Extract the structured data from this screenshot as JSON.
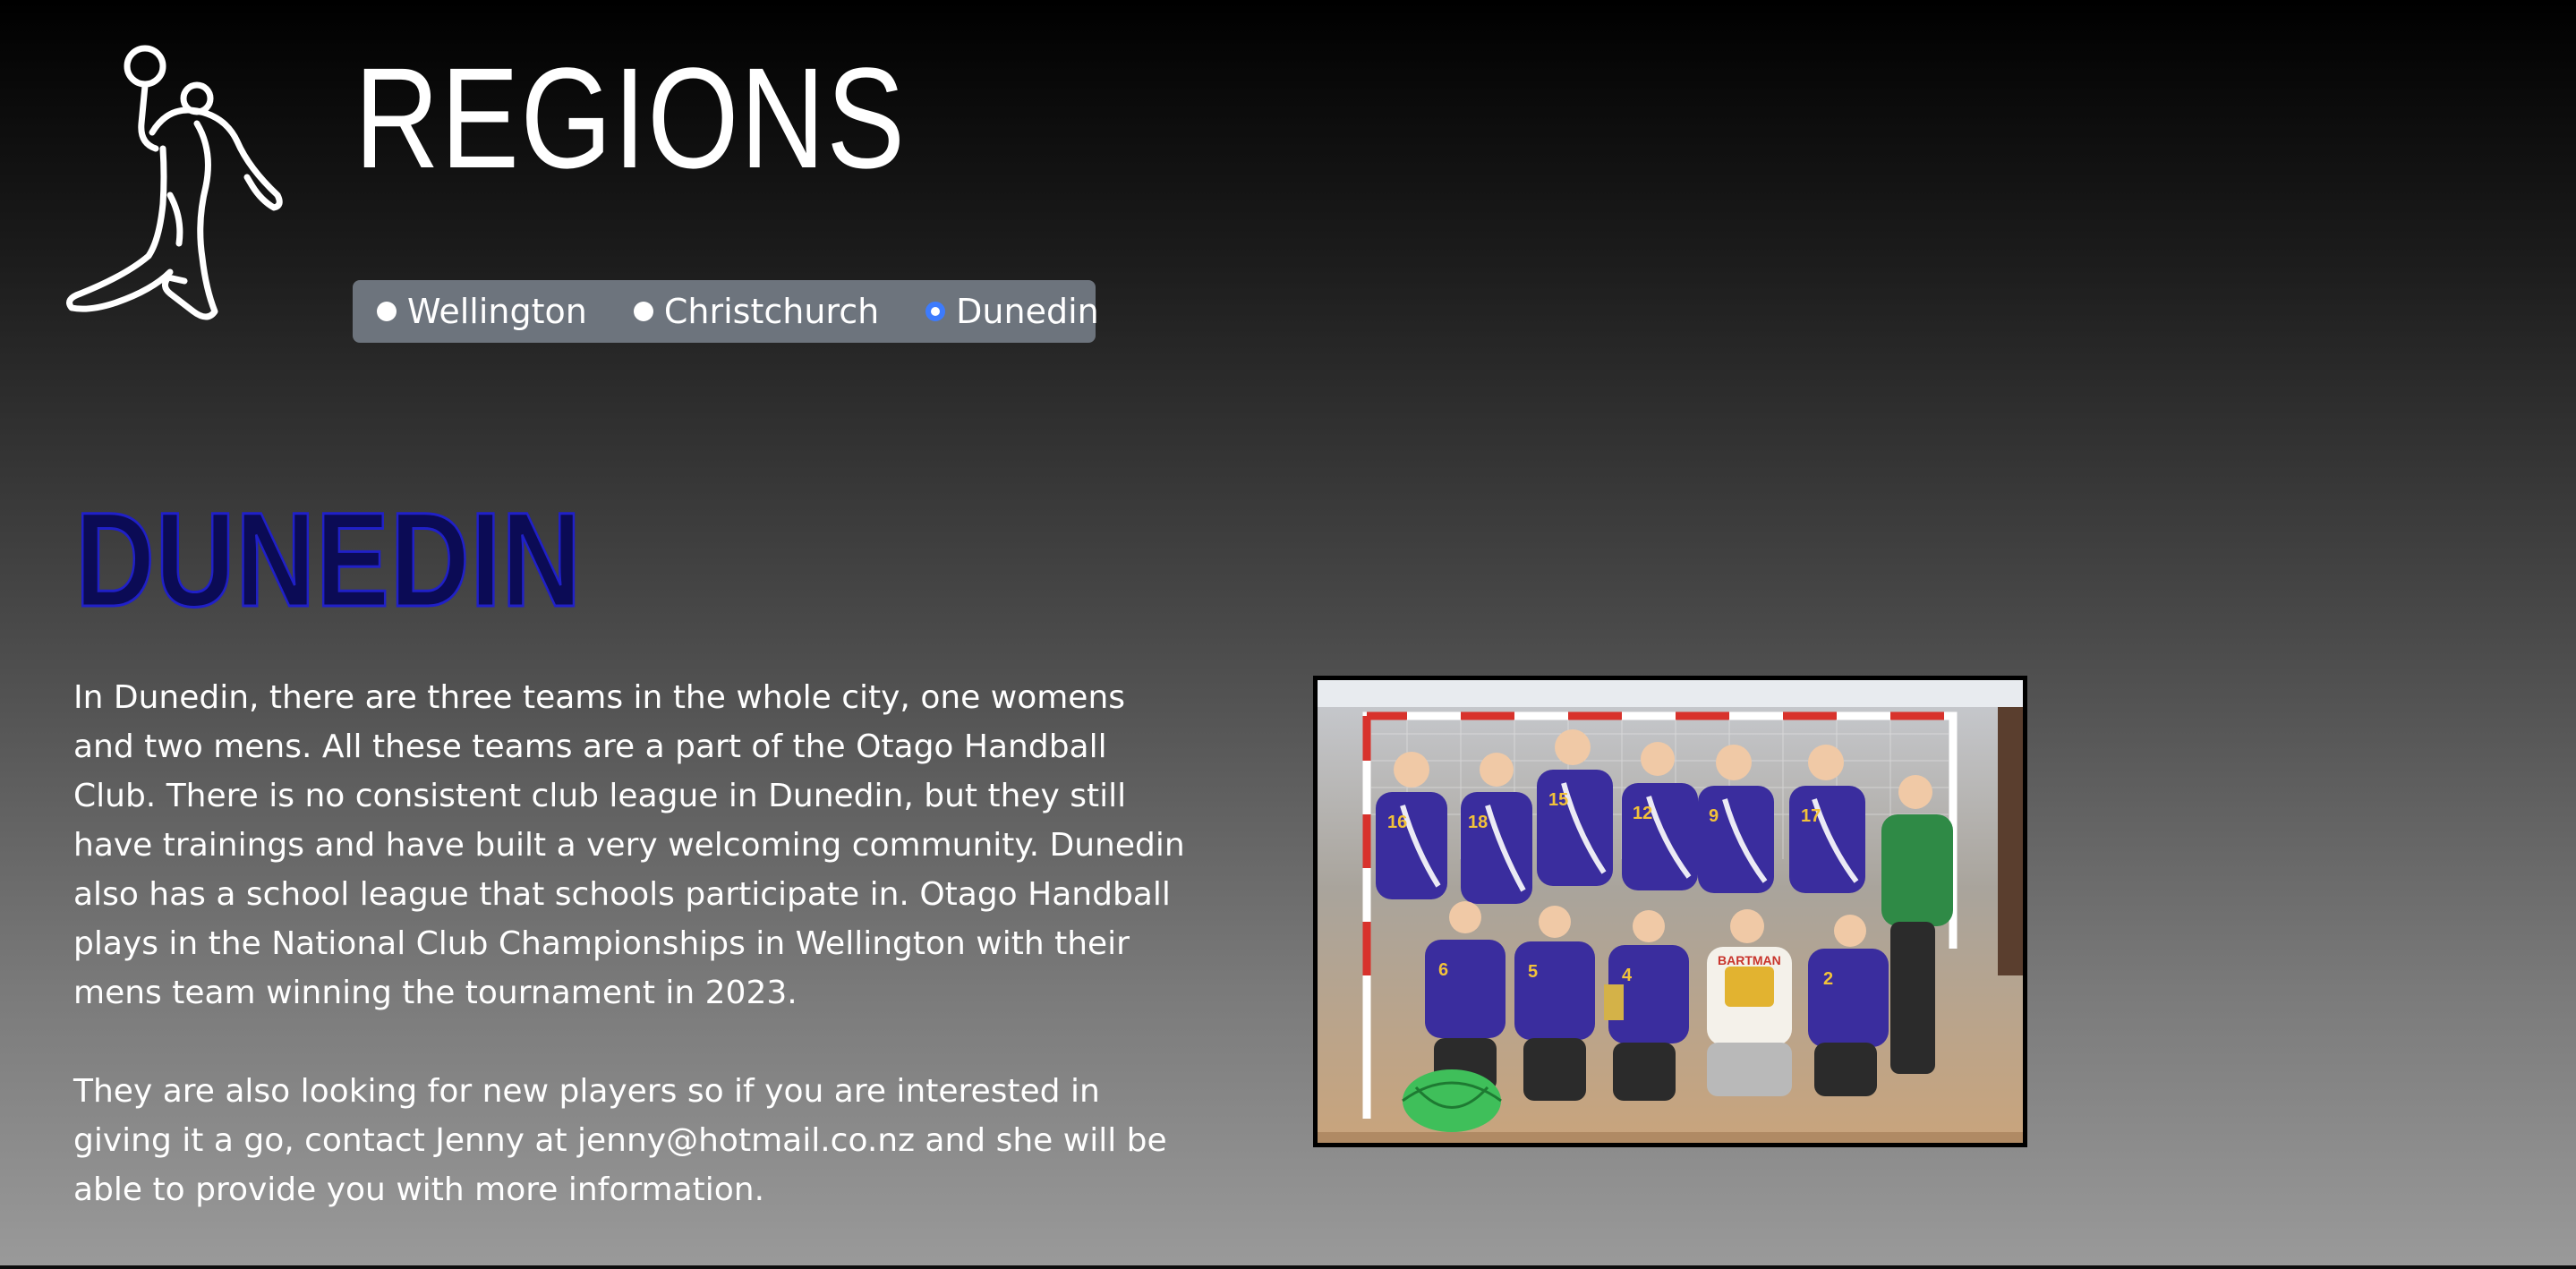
{
  "header": {
    "title": "REGIONS",
    "logo_icon": "handball-player-icon"
  },
  "region_nav": {
    "options": [
      {
        "label": "Wellington",
        "checked": false
      },
      {
        "label": "Christchurch",
        "checked": false
      },
      {
        "label": "Dunedin",
        "checked": true
      }
    ]
  },
  "section": {
    "heading": "DUNEDIN",
    "paragraphs": [
      "In Dunedin, there are three teams in the whole city, one womens and two mens. All these teams are a part of the Otago Handball Club. There is no consistent club league in Dunedin, but they still have trainings and have built a very welcoming community. Dunedin also has a school league that schools participate in. Otago Handball plays in the National Club Championships in Wellington with their mens team winning the tournament in 2023.",
      "They are also looking for new players so if you are interested in giving it a go, contact Jenny at jenny@hotmail.co.nz and she will be able to provide you with more information."
    ],
    "photo": {
      "jersey_numbers": [
        "16",
        "18",
        "15",
        "12",
        "9",
        "17",
        "6",
        "5",
        "4",
        "2"
      ],
      "shirt_print": "BARTMAN"
    }
  },
  "colors": {
    "accent_radio": "#3d7bfd",
    "heading": "#0b0b55",
    "nav_bg": "#6d747d",
    "jersey": "#3a2d9e"
  }
}
